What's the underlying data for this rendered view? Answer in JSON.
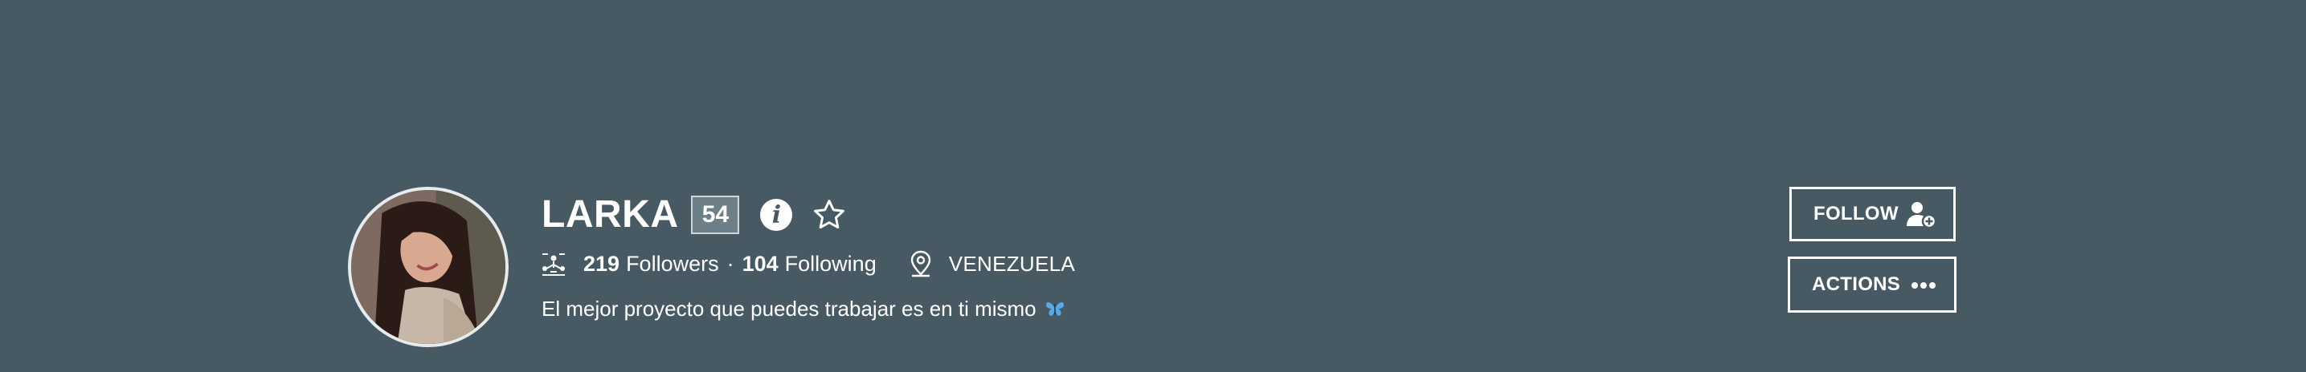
{
  "profile": {
    "username": "LARKA",
    "level": "54",
    "followers_count": "219",
    "followers_label": "Followers",
    "separator": "·",
    "following_count": "104",
    "following_label": "Following",
    "location": "VENEZUELA",
    "bio": "El mejor proyecto que puedes trabajar es en ti mismo"
  },
  "actions": {
    "follow_label": "FOLLOW",
    "actions_label": "ACTIONS"
  },
  "icons": {
    "info": "info-icon",
    "favorite": "star-icon",
    "followers": "network-icon",
    "location": "map-pin-icon",
    "bio_emoji": "butterfly-icon",
    "follow": "add-user-icon",
    "more": "more-dots-icon"
  },
  "colors": {
    "background": "#475a64",
    "text": "#ffffff",
    "badge_bg": "#6d7f88",
    "butterfly": "#5aa9e6"
  }
}
